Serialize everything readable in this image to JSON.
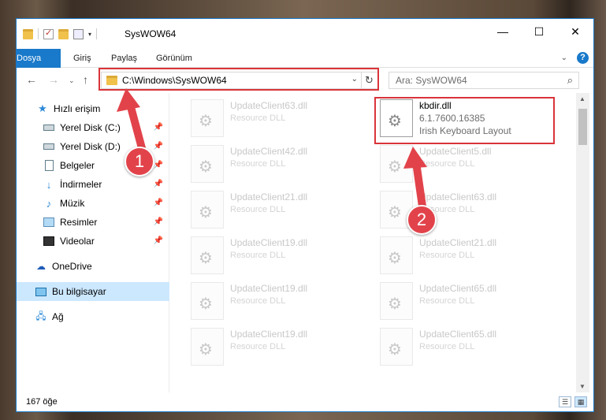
{
  "window": {
    "title": "SysWOW64",
    "controls": {
      "minimize": "—",
      "maximize": "☐",
      "close": "✕"
    }
  },
  "ribbon": {
    "tabs": [
      "Dosya",
      "Giriş",
      "Paylaş",
      "Görünüm"
    ],
    "help": "?",
    "expand": "⌄"
  },
  "address": {
    "path": "C:\\Windows\\SysWOW64",
    "search_placeholder": "Ara: SysWOW64"
  },
  "nav": {
    "items": [
      {
        "label": "Hızlı erişim",
        "icon": "star-icon",
        "pinned": false
      },
      {
        "label": "Yerel Disk (C:)",
        "icon": "disk-icon",
        "pinned": true
      },
      {
        "label": "Yerel Disk (D:)",
        "icon": "disk-icon",
        "pinned": true
      },
      {
        "label": "Belgeler",
        "icon": "document-icon",
        "pinned": true
      },
      {
        "label": "İndirmeler",
        "icon": "download-icon",
        "pinned": true
      },
      {
        "label": "Müzik",
        "icon": "music-icon",
        "pinned": true
      },
      {
        "label": "Resimler",
        "icon": "pictures-icon",
        "pinned": true
      },
      {
        "label": "Videolar",
        "icon": "video-icon",
        "pinned": true
      },
      {
        "label": "OneDrive",
        "icon": "cloud-icon",
        "pinned": false
      },
      {
        "label": "Bu bilgisayar",
        "icon": "computer-icon",
        "pinned": false,
        "selected": true
      },
      {
        "label": "Ağ",
        "icon": "network-icon",
        "pinned": false
      }
    ]
  },
  "files": {
    "left_column": [
      {
        "name": "UpdateClient63.dll",
        "desc": "Resource DLL"
      },
      {
        "name": "UpdateClient42.dll",
        "desc": "Resource DLL"
      },
      {
        "name": "UpdateClient21.dll",
        "desc": "Resource DLL"
      },
      {
        "name": "UpdateClient19.dll",
        "desc": "Resource DLL"
      },
      {
        "name": "UpdateClient19.dll",
        "desc": "Resource DLL"
      },
      {
        "name": "UpdateClient19.dll",
        "desc": "Resource DLL"
      }
    ],
    "selected": {
      "name": "kbdir.dll",
      "version": "6.1.7600.16385",
      "desc": "Irish Keyboard Layout"
    },
    "right_column": [
      {
        "name": "UpdateClient5.dll",
        "desc": "Resource DLL"
      },
      {
        "name": "UpdateClient63.dll",
        "desc": "Resource DLL"
      },
      {
        "name": "UpdateClient21.dll",
        "desc": "Resource DLL"
      },
      {
        "name": "UpdateClient65.dll",
        "desc": "Resource DLL"
      },
      {
        "name": "UpdateClient65.dll",
        "desc": "Resource DLL"
      }
    ]
  },
  "status": {
    "count": "167 öğe"
  },
  "annotations": {
    "marker1": "1",
    "marker2": "2",
    "color": "#e2434b"
  }
}
